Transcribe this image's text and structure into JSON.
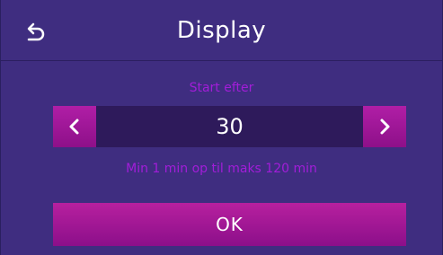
{
  "header": {
    "title": "Display",
    "back_icon": "back-arrow-icon"
  },
  "setting": {
    "label": "Start efter",
    "value": "30",
    "range_hint": "Min 1 min op til maks 120 min",
    "decrement_icon": "chevron-left-icon",
    "increment_icon": "chevron-right-icon"
  },
  "actions": {
    "ok_label": "OK"
  },
  "colors": {
    "background": "#3f2d80",
    "accent": "#a21dd8",
    "button": "#9e139d",
    "stepper_field": "#2e1a5b"
  }
}
